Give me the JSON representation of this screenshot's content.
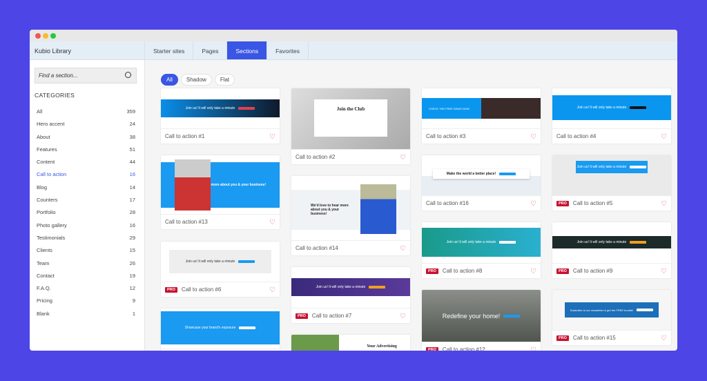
{
  "window": {
    "title": "Kubio Library",
    "dots": [
      "#ee5a52",
      "#f5bd2f",
      "#28c840"
    ]
  },
  "tabs": [
    {
      "label": "Starter sites"
    },
    {
      "label": "Pages"
    },
    {
      "label": "Sections",
      "active": true
    },
    {
      "label": "Favorites"
    }
  ],
  "search": {
    "placeholder": "Find a section..."
  },
  "categories_title": "CATEGORIES",
  "categories": [
    {
      "label": "All",
      "count": "359"
    },
    {
      "label": "Hero accent",
      "count": "24"
    },
    {
      "label": "About",
      "count": "38"
    },
    {
      "label": "Features",
      "count": "51"
    },
    {
      "label": "Content",
      "count": "44"
    },
    {
      "label": "Call to action",
      "count": "16",
      "selected": true
    },
    {
      "label": "Blog",
      "count": "14"
    },
    {
      "label": "Counters",
      "count": "17"
    },
    {
      "label": "Portfolio",
      "count": "28"
    },
    {
      "label": "Photo gallery",
      "count": "16"
    },
    {
      "label": "Testimonials",
      "count": "29"
    },
    {
      "label": "Clients",
      "count": "15"
    },
    {
      "label": "Team",
      "count": "26"
    },
    {
      "label": "Contact",
      "count": "19"
    },
    {
      "label": "F.A.Q.",
      "count": "12"
    },
    {
      "label": "Pricing",
      "count": "9"
    },
    {
      "label": "Blank",
      "count": "1"
    }
  ],
  "filters": [
    {
      "label": "All",
      "active": true
    },
    {
      "label": "Shadow"
    },
    {
      "label": "Flat"
    }
  ],
  "pro_label": "PRO",
  "accent": "#3a56e4",
  "cards": [
    {
      "title": "Call to action #1",
      "pro": false,
      "thumb": "Join us! It will only take a minute"
    },
    {
      "title": "Call to action #13",
      "pro": false,
      "thumb": "We'd love to hear more about you & your business!"
    },
    {
      "title": "Call to action #6",
      "pro": true,
      "thumb": "Join us! It will only take a minute"
    },
    {
      "title": "",
      "pro": false,
      "thumb": "Showcase your brand's exposure"
    },
    {
      "title": "Call to action #2",
      "pro": false,
      "thumb": "Join the Club"
    },
    {
      "title": "Call to action #14",
      "pro": false,
      "thumb": "We'd love to hear more about you & your business!"
    },
    {
      "title": "Call to action #7",
      "pro": true,
      "thumb": "Join us! It will only take a minute"
    },
    {
      "title": "",
      "pro": false,
      "thumb": "Your Advertising"
    },
    {
      "title": "Call to action #3",
      "pro": false,
      "thumb": "CHECK THE FREE DEMO NOW"
    },
    {
      "title": "Call to action #16",
      "pro": false,
      "thumb": "Make the world a better place!"
    },
    {
      "title": "Call to action #8",
      "pro": true,
      "thumb": "Join us! It will only take a minute"
    },
    {
      "title": "Call to action #12",
      "pro": true,
      "thumb": "Redefine your home!"
    },
    {
      "title": "Call to action #4",
      "pro": false,
      "thumb": "Join us! It will only take a minute"
    },
    {
      "title": "Call to action #5",
      "pro": true,
      "thumb": "Join us! It will only take a minute"
    },
    {
      "title": "Call to action #9",
      "pro": true,
      "thumb": "Join us! It will only take a minute"
    },
    {
      "title": "Call to action #15",
      "pro": true,
      "thumb": "Subscribe to our newsletter & get the FREE bundle!"
    }
  ]
}
